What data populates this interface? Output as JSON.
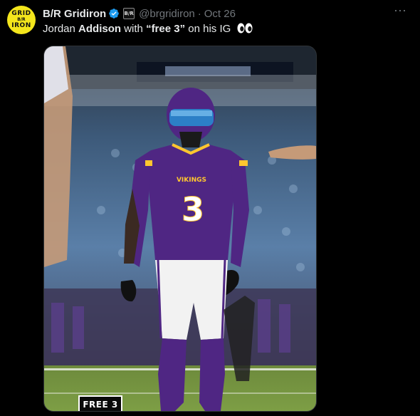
{
  "author": {
    "display_name": "B/R Gridiron",
    "handle": "@brgridiron",
    "separator": "·",
    "date": "Oct 26",
    "avatar_text": [
      "GRID",
      "B/R",
      "IRON"
    ],
    "verified_color": "#1d9bf0",
    "affiliation_badge": "B/R"
  },
  "tweet": {
    "text_prefix": "Jordan ",
    "text_bold_1": "Addison",
    "text_mid": " with ",
    "text_bold_2": "“free 3”",
    "text_suffix": " on his IG",
    "emoji": "eyes-emoji"
  },
  "media": {
    "alt": "Jordan Addison in a purple Vikings uniform number 3 standing on the field",
    "jersey_brand": "VIKINGS",
    "jersey_number": "3",
    "badge_text": "FREE 3",
    "jersey_color": "#4f2683",
    "accent_color": "#ffc62f"
  },
  "more_label": "···"
}
